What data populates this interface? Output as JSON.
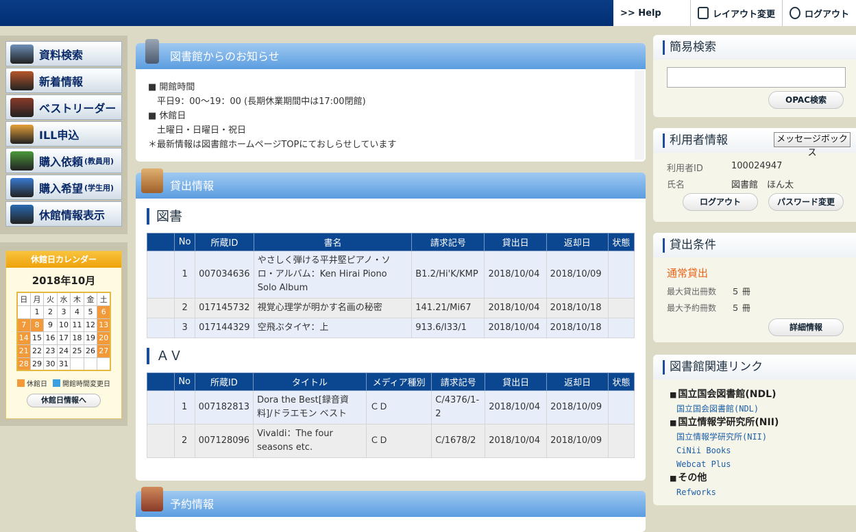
{
  "topnav": {
    "help": ">> Help",
    "layout": "レイアウト変更",
    "logout": "ログアウト"
  },
  "menu": [
    {
      "label": "資料検索",
      "sub": "",
      "icon": "search-icon",
      "color": "#6c8fb8"
    },
    {
      "label": "新着情報",
      "sub": "",
      "icon": "new-book-icon",
      "color": "#b8562a"
    },
    {
      "label": "ベストリーダー",
      "sub": "",
      "icon": "star-book-icon",
      "color": "#8a3a2a"
    },
    {
      "label": "ILL申込",
      "sub": "",
      "icon": "ill-icon",
      "color": "#e5a03a"
    },
    {
      "label": "購入依頼",
      "sub": "(教員用)",
      "icon": "purchase-request-icon",
      "color": "#4a9a3a"
    },
    {
      "label": "購入希望",
      "sub": "(学生用)",
      "icon": "purchase-wish-icon",
      "color": "#3a7ad0"
    },
    {
      "label": "休館情報表示",
      "sub": "",
      "icon": "closed-info-icon",
      "color": "#2a6ab0"
    }
  ],
  "calendar": {
    "title": "休館日カレンダー",
    "month": "2018年10月",
    "dow": [
      "日",
      "月",
      "火",
      "水",
      "木",
      "金",
      "土"
    ],
    "weeks": [
      [
        "",
        "1",
        "2",
        "3",
        "4",
        "5",
        "6"
      ],
      [
        "7",
        "8",
        "9",
        "10",
        "11",
        "12",
        "13"
      ],
      [
        "14",
        "15",
        "16",
        "17",
        "18",
        "19",
        "20"
      ],
      [
        "21",
        "22",
        "23",
        "24",
        "25",
        "26",
        "27"
      ],
      [
        "28",
        "29",
        "30",
        "31",
        "",
        "",
        ""
      ]
    ],
    "holidays": [
      "6",
      "7",
      "8",
      "13",
      "14",
      "20",
      "21",
      "27",
      "28"
    ],
    "legend_closed": "休館日",
    "legend_changed": "開館時間変更日",
    "closed_color": "#f29a3a",
    "changed_color": "#3aa0e0",
    "button": "休館日情報へ"
  },
  "notice": {
    "title": "図書館からのお知らせ",
    "lines": [
      "■ 開館時間",
      "　平日9：00～19：00 (長期休業期間中は17:00閉館)",
      "■ 休館日",
      "　土曜日・日曜日・祝日",
      "＊最新情報は図書館ホームページTOPにておしらせしています"
    ]
  },
  "loan": {
    "title": "貸出情報",
    "books": {
      "heading": "図書",
      "columns": [
        "",
        "No",
        "所蔵ID",
        "書名",
        "請求記号",
        "貸出日",
        "返却日",
        "状態"
      ],
      "rows": [
        [
          "",
          "1",
          "007034636",
          "やさしく弾ける平井堅ピアノ・ソロ・アルバム：Ken Hirai Piono Solo Album",
          "B1.2/Hi'K/KMP",
          "2018/10/04",
          "2018/10/09",
          ""
        ],
        [
          "",
          "2",
          "017145732",
          "視覚心理学が明かす名画の秘密",
          "141.21/Mi67",
          "2018/10/04",
          "2018/10/18",
          ""
        ],
        [
          "",
          "3",
          "017144329",
          "空飛ぶタイヤ：上",
          "913.6/I33/1",
          "2018/10/04",
          "2018/10/18",
          ""
        ]
      ]
    },
    "av": {
      "heading": "ＡＶ",
      "columns": [
        "",
        "No",
        "所蔵ID",
        "タイトル",
        "メディア種別",
        "請求記号",
        "貸出日",
        "返却日",
        "状態"
      ],
      "rows": [
        [
          "",
          "1",
          "007182813",
          "Dora the Best[録音資料]/ドラエモン ベスト",
          "ＣＤ",
          "C/4376/1-2",
          "2018/10/04",
          "2018/10/09",
          ""
        ],
        [
          "",
          "2",
          "007128096",
          "Vivaldi：The four seasons etc.",
          "ＣＤ",
          "C/1678/2",
          "2018/10/04",
          "2018/10/09",
          ""
        ]
      ]
    }
  },
  "reservation": {
    "title": "予約情報"
  },
  "quick_search": {
    "title": "簡易検索",
    "value": "",
    "button": "OPAC検索"
  },
  "user": {
    "title": "利用者情報",
    "message_button": "メッセージボックス",
    "id_label": "利用者ID",
    "id": "100024947",
    "name_label": "氏名",
    "name": "図書館　ほん太",
    "logout": "ログアウト",
    "password": "パスワード変更"
  },
  "conditions": {
    "title": "貸出条件",
    "type": "通常貸出",
    "max_loan_label": "最大貸出冊数",
    "max_loan": "５ 冊",
    "max_reserve_label": "最大予約冊数",
    "max_reserve": "５ 冊",
    "button": "詳細情報"
  },
  "links": {
    "title": "図書館関連リンク",
    "groups": [
      {
        "heading": "国立国会図書館(NDL)",
        "items": [
          "国立国会図書館(NDL)"
        ]
      },
      {
        "heading": "国立情報学研究所(NII)",
        "items": [
          "国立情報学研究所(NII)",
          "CiNii Books",
          "Webcat Plus"
        ]
      },
      {
        "heading": "その他",
        "items": [
          "Refworks"
        ]
      }
    ]
  }
}
